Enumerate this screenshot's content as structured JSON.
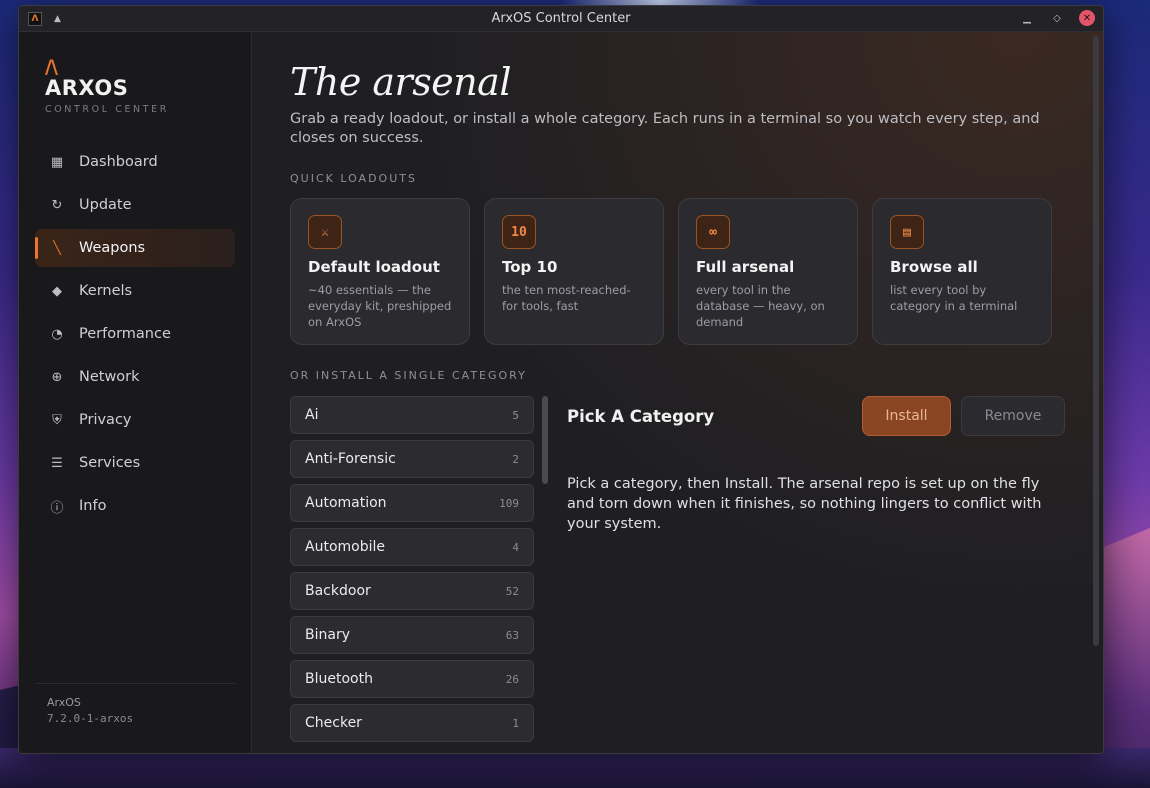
{
  "window": {
    "title": "ArxOS Control Center"
  },
  "brand": {
    "mark": "/\\",
    "name": "ARXOS",
    "subtitle": "CONTROL CENTER"
  },
  "nav": [
    {
      "label": "Dashboard",
      "icon": "grid-icon",
      "active": false
    },
    {
      "label": "Update",
      "icon": "refresh-icon",
      "active": false
    },
    {
      "label": "Weapons",
      "icon": "blade-icon",
      "active": true
    },
    {
      "label": "Kernels",
      "icon": "chip-icon",
      "active": false
    },
    {
      "label": "Performance",
      "icon": "gauge-icon",
      "active": false
    },
    {
      "label": "Network",
      "icon": "globe-icon",
      "active": false
    },
    {
      "label": "Privacy",
      "icon": "shield-icon",
      "active": false
    },
    {
      "label": "Services",
      "icon": "list-icon",
      "active": false
    },
    {
      "label": "Info",
      "icon": "info-icon",
      "active": false
    }
  ],
  "footer": {
    "name": "ArxOS",
    "version": "7.2.0-1-arxos"
  },
  "page": {
    "title": "The arsenal",
    "description": "Grab a ready loadout, or install a whole category. Each runs in a terminal so you watch every step, and closes on success.",
    "quick_label": "QUICK LOADOUTS",
    "category_label": "OR INSTALL A SINGLE CATEGORY"
  },
  "loadouts": [
    {
      "icon": "⚔",
      "title": "Default loadout",
      "desc": "~40 essentials — the everyday kit, preshipped on ArxOS"
    },
    {
      "icon": "10",
      "title": "Top 10",
      "desc": "the ten most-reached-for tools, fast"
    },
    {
      "icon": "∞",
      "title": "Full arsenal",
      "desc": "every tool in the database — heavy, on demand"
    },
    {
      "icon": "▤",
      "title": "Browse all",
      "desc": "list every tool by category in a terminal"
    }
  ],
  "categories": [
    {
      "name": "Ai",
      "count": "5"
    },
    {
      "name": "Anti-Forensic",
      "count": "2"
    },
    {
      "name": "Automation",
      "count": "109"
    },
    {
      "name": "Automobile",
      "count": "4"
    },
    {
      "name": "Backdoor",
      "count": "52"
    },
    {
      "name": "Binary",
      "count": "63"
    },
    {
      "name": "Bluetooth",
      "count": "26"
    },
    {
      "name": "Checker",
      "count": "1"
    }
  ],
  "detail": {
    "title": "Pick A Category",
    "install_label": "Install",
    "remove_label": "Remove",
    "text": "Pick a category, then Install. The arsenal repo is set up on the fly and torn down when it finishes, so nothing lingers to conflict with your system."
  },
  "colors": {
    "accent": "#e8742d",
    "bg": "#1f1f23",
    "sidebar": "#19191c"
  }
}
